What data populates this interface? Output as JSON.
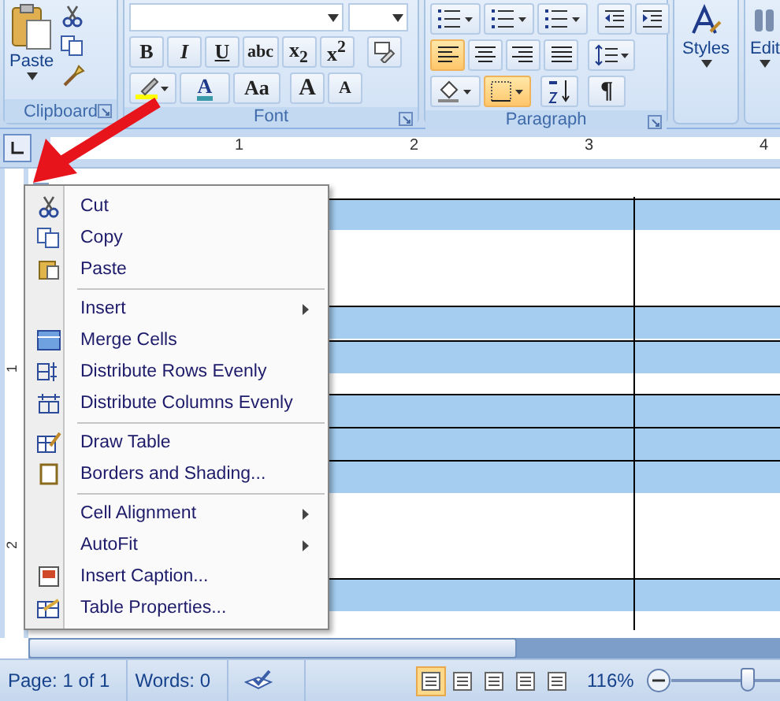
{
  "ribbon": {
    "clipboard": {
      "label": "Clipboard",
      "paste": "Paste"
    },
    "font": {
      "label": "Font",
      "format_buttons": [
        {
          "text": "B",
          "kind": "bold"
        },
        {
          "text": "I",
          "kind": "italic"
        },
        {
          "text": "U",
          "kind": "underline"
        },
        {
          "text": "abc",
          "kind": "strike"
        },
        {
          "text": "x$_{2}$",
          "kind": "script"
        },
        {
          "text": "x$^{2}$",
          "kind": "script"
        }
      ],
      "color_letter": "A",
      "case_button": "Aa",
      "grow_button": "A",
      "shrink_button": "A"
    },
    "paragraph": {
      "label": "Paragraph",
      "align_buttons": [
        {
          "selected": true
        },
        {
          "selected": false
        },
        {
          "selected": false
        },
        {
          "selected": false
        }
      ],
      "borders_button": {
        "selected": true
      },
      "show_marks": "¶"
    },
    "styles": {
      "label": "Styles"
    },
    "editing": {
      "label": "Edit"
    }
  },
  "ruler": {
    "numbers": [
      "1",
      "2",
      "3",
      "4"
    ],
    "vertical_numbers": [
      "1",
      "2"
    ]
  },
  "context_menu": {
    "groups": [
      [
        {
          "label": "Cut",
          "submenu": false
        },
        {
          "label": "Copy",
          "submenu": false
        },
        {
          "label": "Paste",
          "submenu": false
        }
      ],
      [
        {
          "label": "Insert",
          "submenu": true
        },
        {
          "label": "Merge Cells",
          "submenu": false
        },
        {
          "label": "Distribute Rows Evenly",
          "submenu": false
        },
        {
          "label": "Distribute Columns Evenly",
          "submenu": false
        }
      ],
      [
        {
          "label": "Draw Table",
          "submenu": false
        },
        {
          "label": "Borders and Shading...",
          "submenu": false
        }
      ],
      [
        {
          "label": "Cell Alignment",
          "submenu": true
        },
        {
          "label": "AutoFit",
          "submenu": true
        },
        {
          "label": "Insert Caption...",
          "submenu": false
        },
        {
          "label": "Table Properties...",
          "submenu": false
        }
      ]
    ]
  },
  "status_bar": {
    "page": "Page: 1 of 1",
    "words": "Words: 0",
    "views": [
      {
        "selected": true
      },
      {
        "selected": false
      },
      {
        "selected": false
      },
      {
        "selected": false
      },
      {
        "selected": false
      }
    ],
    "zoom": "116%",
    "zoom_slider": {
      "level": 0.7
    }
  }
}
